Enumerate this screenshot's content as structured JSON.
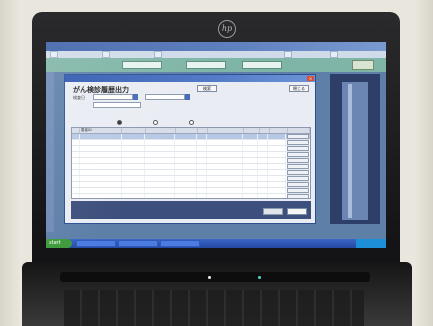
{
  "laptop": {
    "brand_logo": "hp"
  },
  "background_app": {
    "title": "",
    "tabs": [
      "",
      "",
      "",
      "",
      ""
    ],
    "header_fields": [
      "",
      "",
      ""
    ],
    "side_button": ""
  },
  "dialog": {
    "title": "",
    "heading": "がん検診履歴出力",
    "search_button": "検索",
    "close_button": "閉じる",
    "criteria": {
      "label_1": "検査日",
      "label_2": "",
      "label_3": "",
      "input_1_value": "",
      "input_2_value": "",
      "input_3_value": ""
    },
    "radios": [
      "",
      "",
      ""
    ],
    "grid": {
      "columns": [
        "",
        "患者ID",
        "",
        "",
        "",
        "",
        "",
        "",
        "",
        "",
        ""
      ],
      "row_count": 12,
      "row_button_label": ""
    },
    "footer_buttons": [
      "",
      ""
    ]
  },
  "taskbar": {
    "start_label": "start",
    "items": [
      "",
      "",
      ""
    ],
    "clock": ""
  }
}
